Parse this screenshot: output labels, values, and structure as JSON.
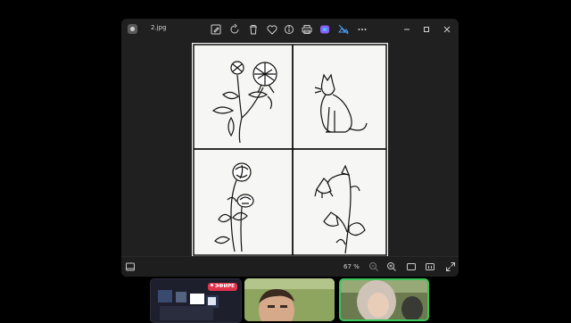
{
  "viewer": {
    "filename": "2.jpg",
    "zoom": "67 %",
    "toolbar": [
      "edit-icon",
      "rotate-icon",
      "delete-icon",
      "favorite-icon",
      "info-icon",
      "print-icon",
      "copilot-icon",
      "visual-search-icon",
      "more-icon"
    ],
    "window_controls": [
      "minimize",
      "maximize",
      "close"
    ]
  },
  "image": {
    "panels": [
      "clover flower",
      "cat",
      "rose flowers",
      "bellflowers"
    ]
  },
  "call": {
    "live_label": "ЭФИРЕ",
    "live_color": "#e0344c",
    "active_speaker_border": "#3cc45c"
  }
}
